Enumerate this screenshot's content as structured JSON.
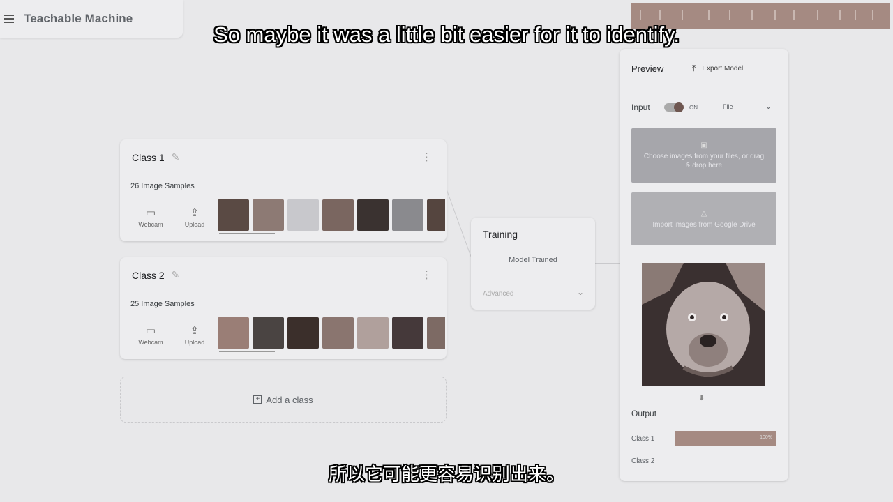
{
  "app": {
    "title": "Teachable Machine"
  },
  "subtitles": {
    "english": "So maybe it was a little bit easier for it to identify.",
    "chinese": "所以它可能更容易识别出来。"
  },
  "classes": [
    {
      "name": "Class 1",
      "samples_label": "26 Image Samples",
      "webcam_label": "Webcam",
      "upload_label": "Upload",
      "thumb_colors": [
        "#5a4a44",
        "#8d7a74",
        "#c8c8cc",
        "#7a6660",
        "#3a3230",
        "#8a8a8e",
        "#55453f"
      ]
    },
    {
      "name": "Class 2",
      "samples_label": "25 Image Samples",
      "webcam_label": "Webcam",
      "upload_label": "Upload",
      "thumb_colors": [
        "#9a7e76",
        "#4a4442",
        "#3b2f2b",
        "#8a756f",
        "#b0a09c",
        "#45393a",
        "#7d6a64"
      ]
    }
  ],
  "add_class": {
    "label": "Add a class"
  },
  "training": {
    "title": "Training",
    "status": "Model Trained",
    "advanced_label": "Advanced"
  },
  "preview": {
    "title": "Preview",
    "export_label": "Export Model",
    "input_label": "Input",
    "toggle_state": "ON",
    "source_value": "File",
    "dropzone_text": "Choose images from your files, or drag & drop here",
    "drive_text": "Import images from Google Drive",
    "output_label": "Output",
    "outputs": [
      {
        "label": "Class 1",
        "value_text": "100%",
        "fraction": 1.0,
        "color": "#a58a82"
      },
      {
        "label": "Class 2",
        "value_text": "",
        "fraction": 0.0,
        "color": "#7a7a7e"
      }
    ]
  },
  "icons": {
    "menu": "menu-icon",
    "edit": "pencil-icon",
    "more": "more-vert-icon",
    "webcam": "videocam-icon",
    "upload": "upload-icon",
    "add": "add-box-icon",
    "chevron": "chevron-down-icon",
    "export": "export-icon",
    "folder": "folder-icon",
    "drive": "google-drive-icon",
    "arrow": "arrow-down-icon"
  },
  "colors": {
    "background": "#e8e8ea",
    "card": "#ededef",
    "accent": "#a58a82",
    "dropzone": "#a6a6ab"
  }
}
